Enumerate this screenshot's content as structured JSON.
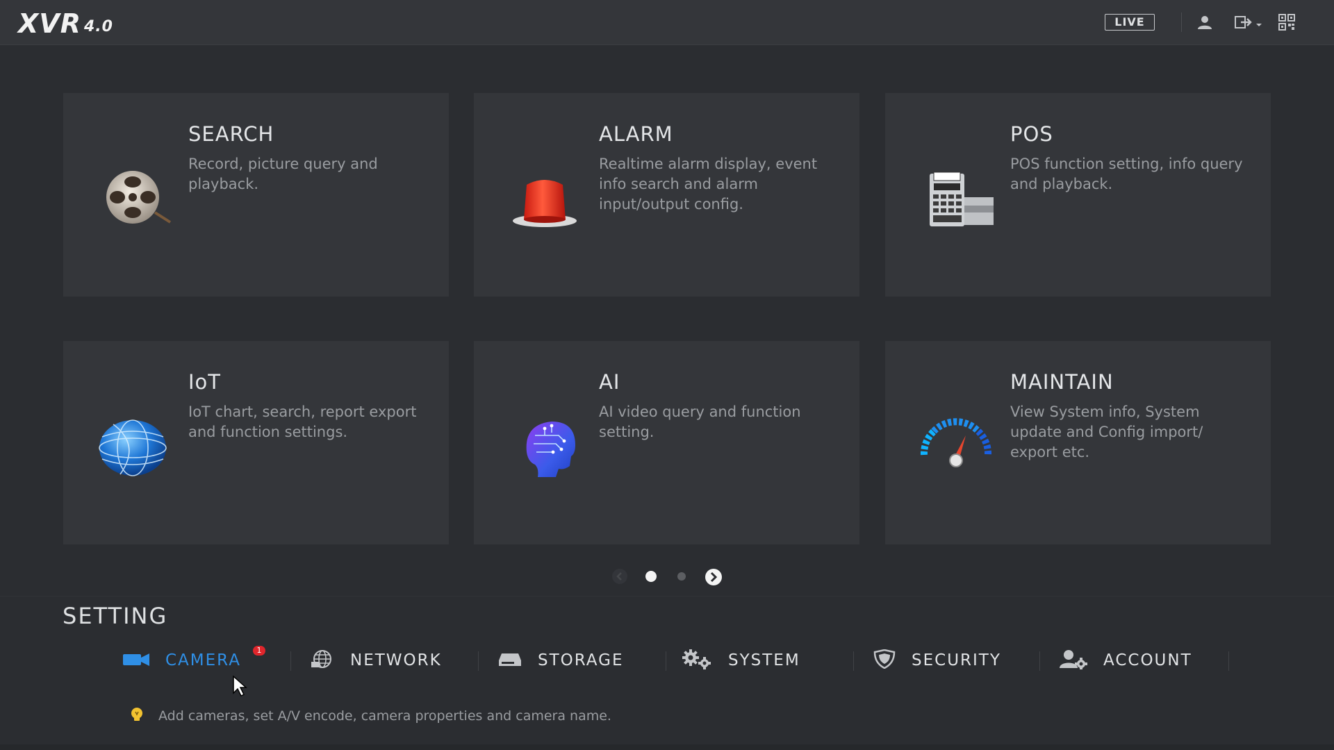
{
  "header": {
    "logo_main": "XVR",
    "logo_version": "4.0",
    "live_label": "LIVE"
  },
  "cards": [
    {
      "title": "SEARCH",
      "desc": "Record, picture query and playback.",
      "icon": "film-reel-icon"
    },
    {
      "title": "ALARM",
      "desc": "Realtime alarm display, event info search and alarm input/output config.",
      "icon": "alarm-siren-icon"
    },
    {
      "title": "POS",
      "desc": "POS function setting, info query and playback.",
      "icon": "cash-register-icon"
    },
    {
      "title": "IoT",
      "desc": "IoT chart, search, report export and function settings.",
      "icon": "globe-icon"
    },
    {
      "title": "AI",
      "desc": "AI video query and function setting.",
      "icon": "ai-head-icon"
    },
    {
      "title": "MAINTAIN",
      "desc": "View System info, System update and Config import/ export etc.",
      "icon": "gauge-icon"
    }
  ],
  "pager": {
    "current_page": 1,
    "total_pages": 2
  },
  "setting": {
    "title": "SETTING",
    "items": [
      {
        "label": "CAMERA",
        "icon": "camera-icon",
        "active": true,
        "badge": "1"
      },
      {
        "label": "NETWORK",
        "icon": "network-globe-icon",
        "active": false
      },
      {
        "label": "STORAGE",
        "icon": "hard-drive-icon",
        "active": false
      },
      {
        "label": "SYSTEM",
        "icon": "gears-icon",
        "active": false
      },
      {
        "label": "SECURITY",
        "icon": "shield-icon",
        "active": false
      },
      {
        "label": "ACCOUNT",
        "icon": "user-gear-icon",
        "active": false
      }
    ],
    "hint": "Add cameras, set A/V encode, camera properties and camera name."
  },
  "colors": {
    "background": "#2b2d31",
    "card": "#34363a",
    "accent": "#2f8fe6",
    "badge": "#e0262c"
  }
}
